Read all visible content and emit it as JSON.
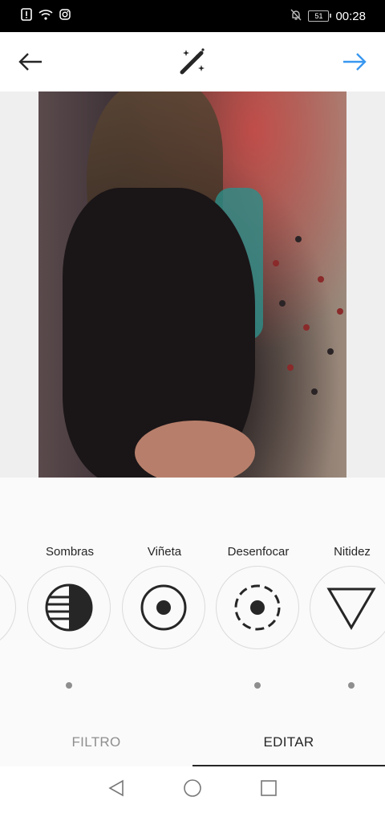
{
  "status_bar": {
    "time": "00:28",
    "battery": "51"
  },
  "app_bar": {
    "back_icon": "arrow-left-icon",
    "center_icon": "magic-wand-icon",
    "next_icon": "arrow-right-icon",
    "accent_color": "#3897f0"
  },
  "photo": {
    "description_icon": "photo-preview"
  },
  "tools": [
    {
      "label": "",
      "icon": "partial-tool-icon"
    },
    {
      "label": "Sombras",
      "icon": "shadows-icon"
    },
    {
      "label": "Viñeta",
      "icon": "vignette-icon"
    },
    {
      "label": "Desenfocar",
      "icon": "tilt-shift-icon"
    },
    {
      "label": "Nitidez",
      "icon": "sharpen-icon"
    }
  ],
  "tabs": {
    "filter": "FILTRO",
    "edit": "EDITAR",
    "selected": "EDITAR"
  },
  "nav": {
    "back": "nav-back-icon",
    "home": "nav-home-icon",
    "recents": "nav-recents-icon"
  }
}
